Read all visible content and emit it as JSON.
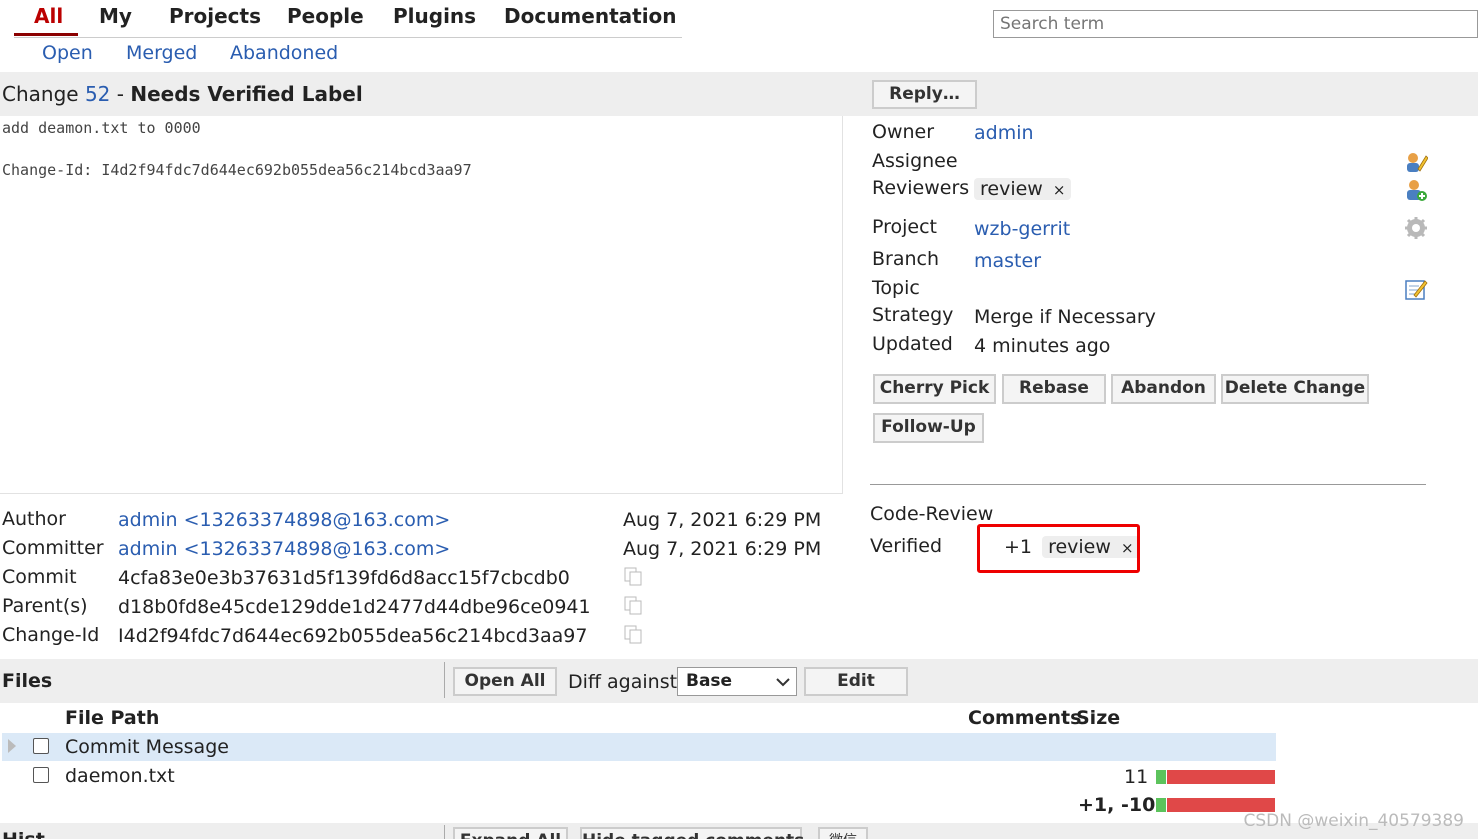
{
  "nav": {
    "tabs": [
      "All",
      "My",
      "Projects",
      "People",
      "Plugins",
      "Documentation"
    ],
    "sub_tabs": [
      "Open",
      "Merged",
      "Abandoned"
    ]
  },
  "search": {
    "placeholder": "Search term"
  },
  "change": {
    "prefix": "Change",
    "number": "52",
    "dash": "-",
    "status": "Needs Verified Label",
    "message_line1": "add deamon.txt to 0000",
    "message_line2": "Change-Id: I4d2f94fdc7d644ec692b055dea56c214bcd3aa97"
  },
  "reply_button": "Reply…",
  "info": {
    "owner_label": "Owner",
    "owner": "admin",
    "assignee_label": "Assignee",
    "reviewers_label": "Reviewers",
    "reviewer": "review",
    "project_label": "Project",
    "project": "wzb-gerrit",
    "branch_label": "Branch",
    "branch": "master",
    "topic_label": "Topic",
    "strategy_label": "Strategy",
    "strategy": "Merge if Necessary",
    "updated_label": "Updated",
    "updated": "4 minutes ago"
  },
  "actions": [
    "Cherry Pick",
    "Rebase",
    "Abandon",
    "Delete Change",
    "Follow-Up"
  ],
  "labels": {
    "code_review": "Code-Review",
    "verified": "Verified",
    "verified_vote": "+1",
    "verified_by": "review",
    "remove_glyph": "×"
  },
  "commit": {
    "author_label": "Author",
    "author": "admin <13263374898@163.com>",
    "author_date": "Aug 7, 2021 6:29 PM",
    "committer_label": "Committer",
    "committer": "admin <13263374898@163.com>",
    "committer_date": "Aug 7, 2021 6:29 PM",
    "commit_label": "Commit",
    "commit": "4cfa83e0e3b37631d5f139fd6d8acc15f7cbcdb0",
    "parent_label": "Parent(s)",
    "parent": "d18b0fd8e45cde129dde1d2477d44dbe96ce0941",
    "changeid_label": "Change-Id",
    "changeid": "I4d2f94fdc7d644ec692b055dea56c214bcd3aa97"
  },
  "files": {
    "title": "Files",
    "open_all": "Open All",
    "diff_against": "Diff against:",
    "diff_base": "Base",
    "edit": "Edit",
    "col_path": "File Path",
    "col_comments": "Comments",
    "col_size": "Size",
    "rows": [
      {
        "path": "Commit Message",
        "size": ""
      },
      {
        "path": "daemon.txt",
        "size": "11"
      }
    ],
    "total": "+1, -10"
  },
  "history": {
    "title": "Hist",
    "expand_all": "Expand All",
    "hide_tagged": "Hide tagged comments",
    "extra": "微信"
  },
  "watermark": "CSDN @weixin_40579389",
  "colors": {
    "link": "#2a5db0",
    "active_tab": "#bb0000",
    "highlight": "#ee0000",
    "bar_added": "#5cc35c",
    "bar_removed": "#e04848"
  }
}
